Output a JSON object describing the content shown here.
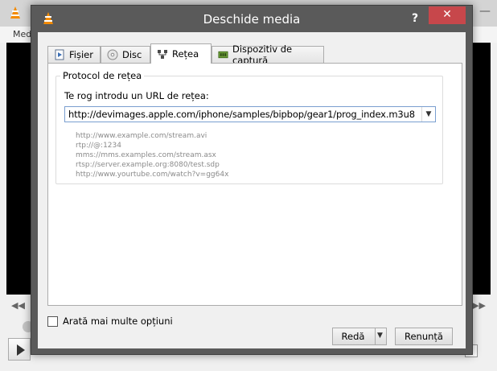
{
  "background": {
    "menu_text": "Med",
    "seek_left": "◀◀",
    "seek_right": "▶▶"
  },
  "dialog": {
    "title": "Deschide media",
    "help_label": "?",
    "close_label": "✕",
    "tabs": [
      {
        "label": "Fișier",
        "icon": "file-icon"
      },
      {
        "label": "Disc",
        "icon": "disc-icon"
      },
      {
        "label": "Rețea",
        "icon": "network-icon",
        "selected": true
      },
      {
        "label": "Dispozitiv de captură",
        "icon": "capture-device-icon"
      }
    ],
    "group_title": "Protocol de rețea",
    "url_label": "Te rog introdu un URL de rețea:",
    "url_value": "http://devimages.apple.com/iphone/samples/bipbop/gear1/prog_index.m3u8",
    "examples": [
      "http://www.example.com/stream.avi",
      "rtp://@:1234",
      "mms://mms.examples.com/stream.asx",
      "rtsp://server.example.org:8080/test.sdp",
      "http://www.yourtube.com/watch?v=gg64x"
    ],
    "more_options_label": "Arată mai multe opțiuni",
    "more_options_checked": false,
    "play_label": "Redă",
    "cancel_label": "Renunță"
  },
  "colors": {
    "titlebar": "#5a5a5a",
    "close_button": "#c7474b",
    "focus_border": "#7a9fd0"
  }
}
